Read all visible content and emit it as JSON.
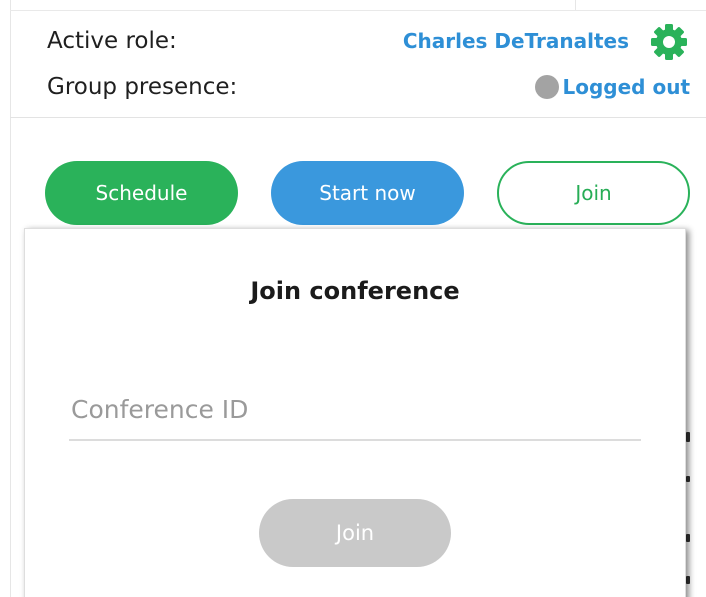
{
  "header": {
    "active_role_label": "Active role:",
    "active_role_value": "Charles DeTranaltes",
    "group_presence_label": "Group presence:",
    "group_presence_value": "Logged out",
    "settings_icon": "gear-icon",
    "presence_status_color": "#a3a3a3"
  },
  "actions": {
    "schedule_label": "Schedule",
    "start_now_label": "Start now",
    "join_label": "Join"
  },
  "join_dialog": {
    "title": "Join conference",
    "conference_id_placeholder": "Conference ID",
    "conference_id_value": "",
    "join_label": "Join"
  },
  "colors": {
    "accent_green": "#2ab25a",
    "accent_blue": "#3a98dd",
    "link_blue": "#2e8fd6",
    "disabled_gray": "#c9c9c9"
  }
}
